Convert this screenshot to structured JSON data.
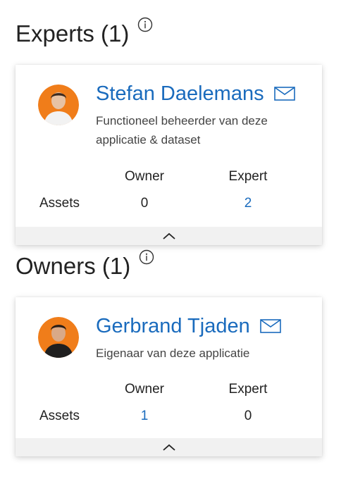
{
  "sections": [
    {
      "title": "Experts (1)",
      "person": {
        "name": "Stefan Daelemans",
        "description": "Functioneel beheerder van deze applicatie & dataset"
      },
      "stats": {
        "owner_header": "Owner",
        "expert_header": "Expert",
        "row_label": "Assets",
        "owner_value": "0",
        "expert_value": "2"
      }
    },
    {
      "title": "Owners (1)",
      "person": {
        "name": "Gerbrand Tjaden",
        "description": "Eigenaar van deze applicatie"
      },
      "stats": {
        "owner_header": "Owner",
        "expert_header": "Expert",
        "row_label": "Assets",
        "owner_value": "1",
        "expert_value": "0"
      }
    }
  ],
  "icons": {
    "info": "info-icon",
    "mail": "mail-icon",
    "collapse": "chevron-up-icon"
  },
  "colors": {
    "link": "#1a6bbd",
    "avatar_bg": "#f07d1a"
  }
}
